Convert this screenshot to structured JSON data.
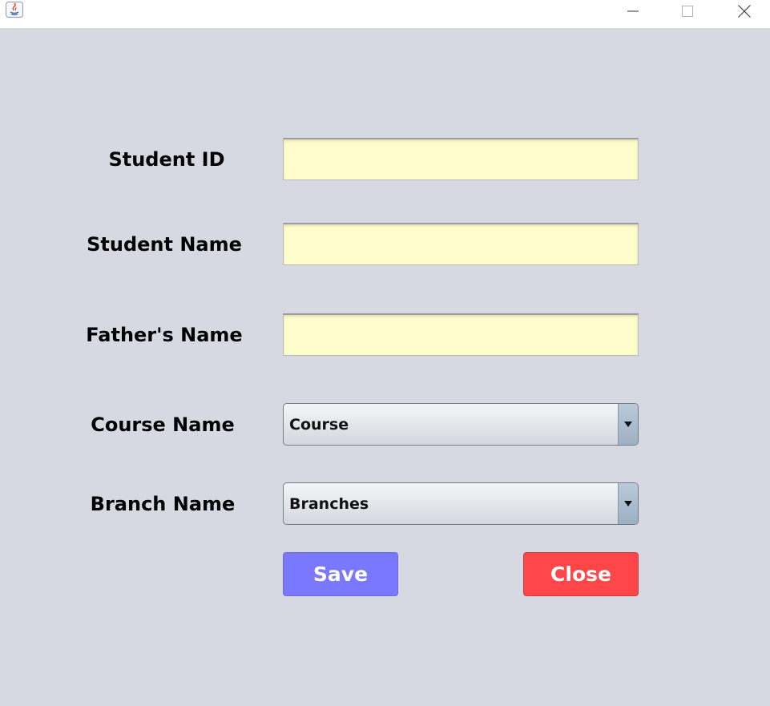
{
  "window": {
    "title": "",
    "icon": "java-icon",
    "controls": [
      "minimize-icon",
      "maximize-icon",
      "close-icon"
    ]
  },
  "form": {
    "student_id": {
      "label": "Student ID",
      "value": ""
    },
    "student_name": {
      "label": "Student Name",
      "value": ""
    },
    "father_name": {
      "label": "Father's Name",
      "value": ""
    },
    "course_name": {
      "label": "Course Name",
      "selected": "Course"
    },
    "branch_name": {
      "label": "Branch Name",
      "selected": "Branches"
    }
  },
  "buttons": {
    "save": {
      "label": "Save",
      "color": "#7a78ff"
    },
    "close": {
      "label": "Close",
      "color": "#ff4649"
    }
  },
  "colors": {
    "background": "#d6d9e1",
    "field_background": "#fffdcc"
  }
}
